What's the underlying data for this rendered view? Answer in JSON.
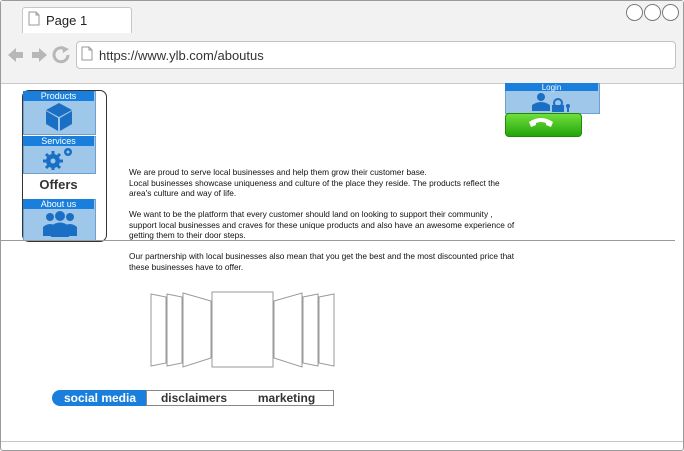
{
  "browser": {
    "tab_title": "Page 1",
    "url": "https://www.ylb.com/aboutus"
  },
  "sidebar": {
    "products_label": "Products",
    "services_label": "Services",
    "offers_label": "Offers",
    "about_label": "About us"
  },
  "header": {
    "login_label": "Login"
  },
  "content": {
    "para1_line1": "We are proud to serve local businesses and help them grow their customer base.",
    "para1_line2": "Local businesses showcase uniqueness and culture of the place they reside. The products reflect the",
    "para1_line3": "area's culture and way of life.",
    "para2_line1": "We want to be the platform that every customer should land on looking to support their community ,",
    "para2_line2": "support local businesses and craves for these unique products and also have an awesome experience of",
    "para2_line3": "getting them to their door steps.",
    "para3_line1": "Our partnership with local businesses also mean that you get the best and the most discounted price that",
    "para3_line2": "these businesses have to offer."
  },
  "footer_tabs": {
    "social": "social media",
    "disclaimers": "disclaimers",
    "marketing": "marketing"
  },
  "colors": {
    "accent": "#1a7fdc",
    "block_fill": "#9fc7ea",
    "phone_green": "#3cbf1c"
  }
}
